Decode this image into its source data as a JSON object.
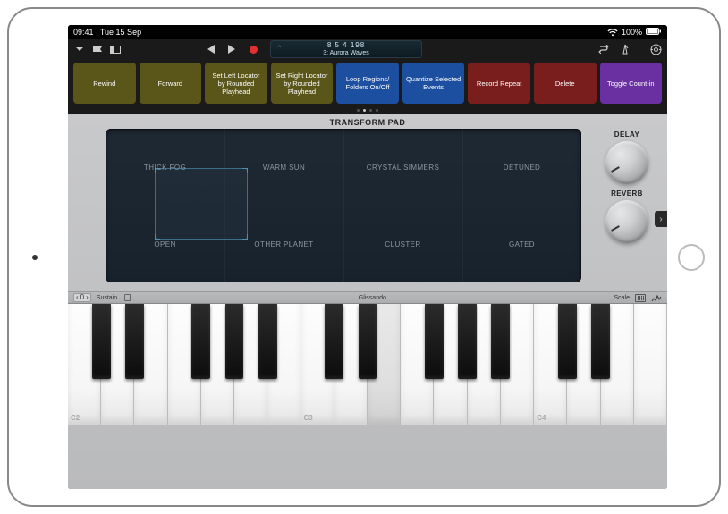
{
  "status": {
    "time": "09:41",
    "date": "Tue 15 Sep",
    "battery": "100%"
  },
  "lcd": {
    "position": "8  5  4  198",
    "track": "3: Aurora Waves"
  },
  "keyCommands": [
    {
      "label": "Rewind",
      "color": "olive"
    },
    {
      "label": "Forward",
      "color": "olive"
    },
    {
      "label": "Set Left Locator by Rounded Playhead",
      "color": "olive"
    },
    {
      "label": "Set Right Locator by Rounded Playhead",
      "color": "olive"
    },
    {
      "label": "Loop Regions/ Folders On/Off",
      "color": "blue"
    },
    {
      "label": "Quantize Selected Events",
      "color": "blue"
    },
    {
      "label": "Record Repeat",
      "color": "red"
    },
    {
      "label": "Delete",
      "color": "red"
    },
    {
      "label": "Toggle Count-in",
      "color": "purple"
    }
  ],
  "transformPad": {
    "title": "TRANSFORM PAD",
    "cells": [
      "THICK FOG",
      "WARM SUN",
      "CRYSTAL SIMMERS",
      "DETUNED",
      "OPEN",
      "OTHER PLANET",
      "CLUSTER",
      "GATED"
    ]
  },
  "knobs": {
    "delay": "DELAY",
    "reverb": "REVERB"
  },
  "kbStrip": {
    "octaveValue": "0",
    "sustain": "Sustain",
    "mode": "Glissando",
    "scale": "Scale"
  },
  "keyboard": {
    "whiteCount": 18,
    "labels": {
      "0": "C2",
      "7": "C3",
      "14": "C4"
    },
    "pressedWhite": [
      9
    ],
    "blackPattern": [
      1,
      1,
      0,
      1,
      1,
      1,
      0
    ]
  }
}
